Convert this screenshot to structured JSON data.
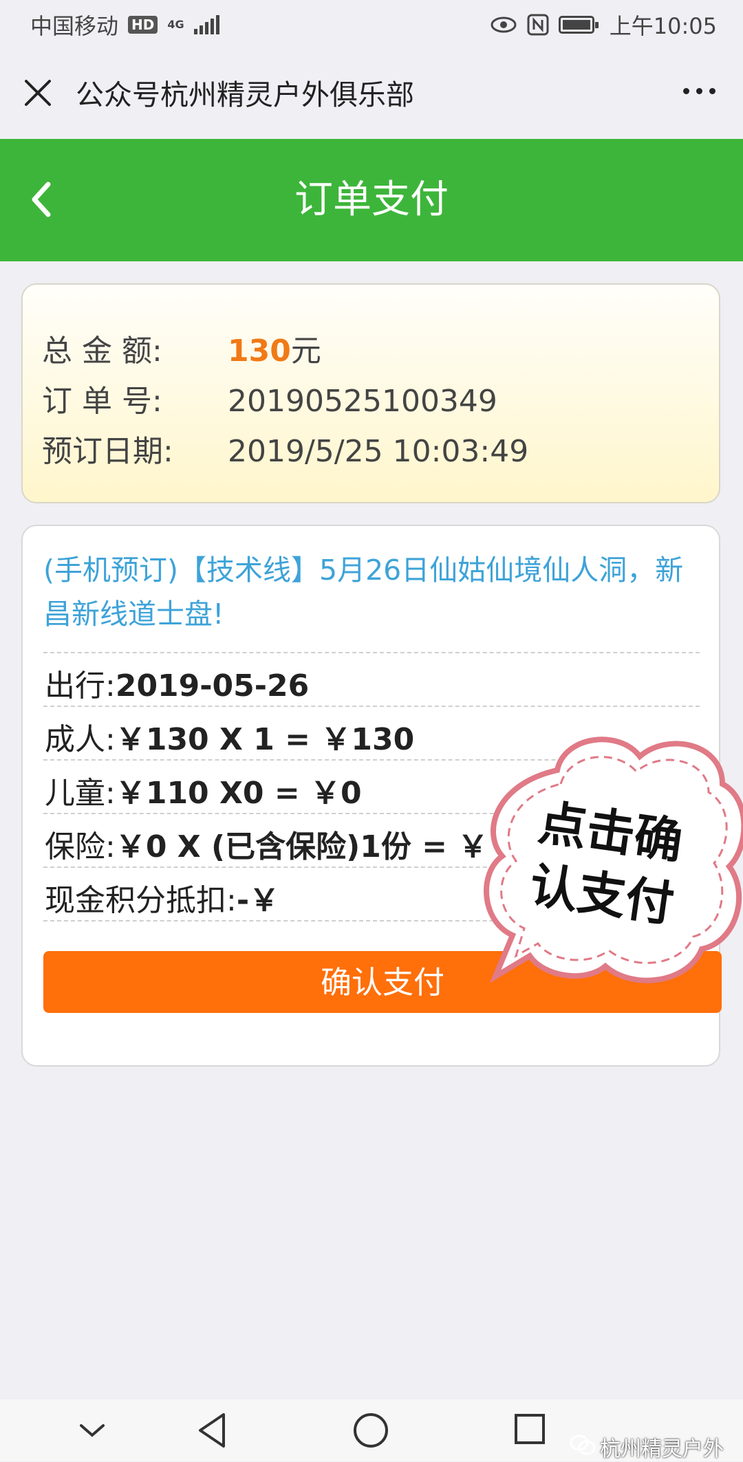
{
  "status_bar": {
    "carrier": "中国移动",
    "hd": "HD",
    "network": "4G",
    "time": "上午10:05"
  },
  "wechat_header": {
    "title": "公众号杭州精灵户外俱乐部"
  },
  "page": {
    "title": "订单支付"
  },
  "order_summary": {
    "total_label": "总 金 额:",
    "total_value": "130",
    "total_unit": "元",
    "order_no_label": "订 单 号:",
    "order_no_value": "20190525100349",
    "date_label": "预订日期:",
    "date_value": "2019/5/25 10:03:49"
  },
  "trip": {
    "title": "(手机预订)【技术线】5月26日仙姑仙境仙人洞，新昌新线道士盘!",
    "depart_label": "出行:",
    "depart_value": "2019-05-26",
    "adult_label": "成人:",
    "adult_value": "￥130 X 1 = ￥130",
    "child_label": "儿童:",
    "child_value": "￥110 X0 = ￥0",
    "insurance_label": "保险:",
    "insurance_value": "￥0 X (已含保险)1份 = ￥",
    "cash_label": "现金积分抵扣:",
    "cash_value": "-￥"
  },
  "pay_button": {
    "label": "确认支付"
  },
  "sticker": {
    "line1": "点击确",
    "line2": "认支付"
  },
  "watermark": "杭州精灵户外",
  "colors": {
    "green": "#3db53a",
    "orange": "#ff6f0a",
    "amount": "#f07a16",
    "link_blue": "#3ea3d8"
  }
}
